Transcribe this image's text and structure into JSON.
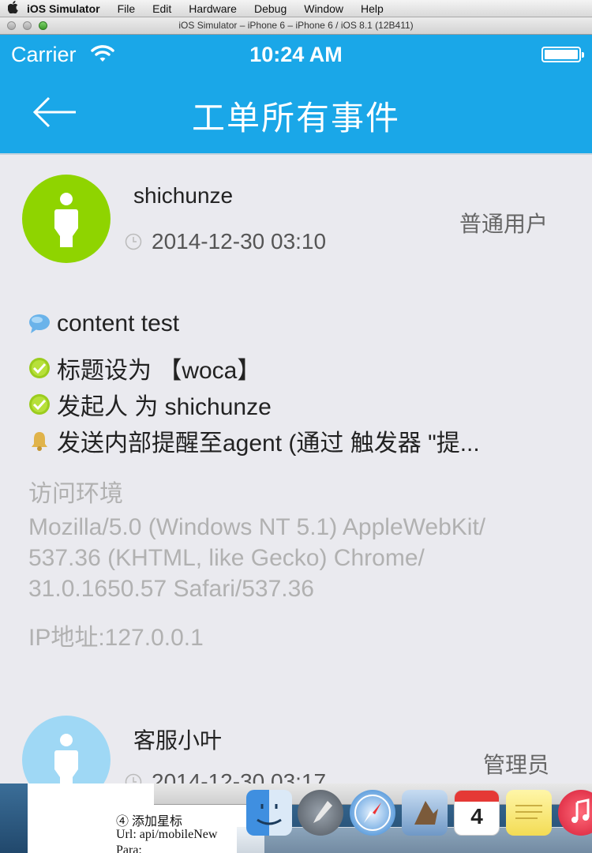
{
  "menubar": {
    "app": "iOS Simulator",
    "items": [
      "File",
      "Edit",
      "Hardware",
      "Debug",
      "Window",
      "Help"
    ]
  },
  "window": {
    "title": "iOS Simulator – iPhone 6 – iPhone 6 / iOS 8.1 (12B411)"
  },
  "statusbar": {
    "carrier": "Carrier",
    "time": "10:24 AM"
  },
  "navbar": {
    "title": "工单所有事件"
  },
  "events": [
    {
      "user": "shichunze",
      "role": "普通用户",
      "time": "2014-12-30 03:10",
      "content": "content test",
      "actions": [
        "标题设为 【woca】",
        "发起人 为 shichunze",
        "发送内部提醒至agent  (通过 触发器 \"提..."
      ],
      "env_label": "访问环境",
      "user_agent_lines": [
        "Mozilla/5.0 (Windows NT 5.1) AppleWebKit/",
        "537.36 (KHTML, like Gecko) Chrome/",
        "31.0.1650.57 Safari/537.36"
      ],
      "ip": "IP地址:127.0.0.1"
    },
    {
      "user": "客服小叶",
      "role": "管理员",
      "time": "2014-12-30 03:17"
    }
  ],
  "colors": {
    "nav": "#1aa7e8",
    "avatar1": "#8fd400",
    "avatar2": "#9fd8f5"
  },
  "document": {
    "lines": [
      "④ 添加星标",
      "Url: api/mobileNew",
      "Para:"
    ]
  },
  "dock": {
    "calendar_day": "4"
  }
}
